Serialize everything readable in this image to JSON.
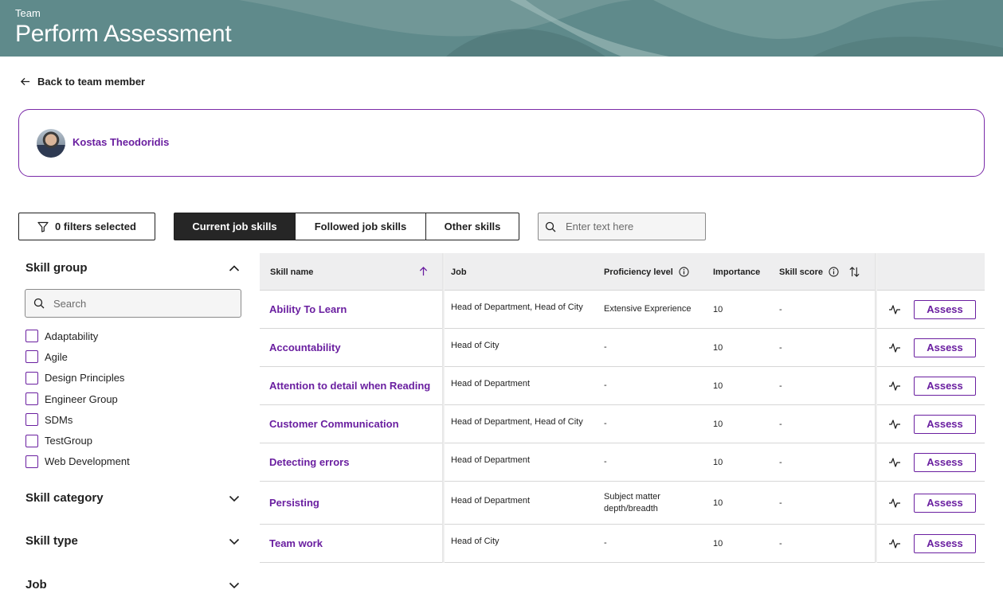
{
  "header": {
    "eyebrow": "Team",
    "title": "Perform Assessment"
  },
  "back_link": {
    "label": "Back to team member"
  },
  "member": {
    "name": "Kostas Theodoridis"
  },
  "toolbar": {
    "filters_label": "0 filters selected",
    "tabs": [
      {
        "label": "Current job skills",
        "active": true
      },
      {
        "label": "Followed job skills",
        "active": false
      },
      {
        "label": "Other skills",
        "active": false
      }
    ],
    "search_placeholder": "Enter text here"
  },
  "sidebar": {
    "skill_group": {
      "title": "Skill group",
      "expanded": true,
      "search_placeholder": "Search",
      "items": [
        "Adaptability",
        "Agile",
        "Design Principles",
        "Engineer Group",
        "SDMs",
        "TestGroup",
        "Web Development"
      ]
    },
    "skill_category": {
      "title": "Skill category",
      "expanded": false
    },
    "skill_type": {
      "title": "Skill type",
      "expanded": false
    },
    "job": {
      "title": "Job",
      "expanded": false
    }
  },
  "table": {
    "columns": {
      "skill_name": "Skill name",
      "job": "Job",
      "proficiency": "Proficiency level",
      "importance": "Importance",
      "skill_score": "Skill score"
    },
    "assess_label": "Assess",
    "rows": [
      {
        "skill": "Ability To Learn",
        "job": "Head of Department, Head of City",
        "proficiency": "Extensive Exprerience",
        "importance": "10",
        "score": "-"
      },
      {
        "skill": "Accountability",
        "job": "Head of City",
        "proficiency": "-",
        "importance": "10",
        "score": "-"
      },
      {
        "skill": "Attention to detail when Reading",
        "job": "Head of Department",
        "proficiency": "-",
        "importance": "10",
        "score": "-"
      },
      {
        "skill": "Customer Communication",
        "job": "Head of Department, Head of City",
        "proficiency": "-",
        "importance": "10",
        "score": "-"
      },
      {
        "skill": "Detecting errors",
        "job": "Head of Department",
        "proficiency": "-",
        "importance": "10",
        "score": "-"
      },
      {
        "skill": "Persisting",
        "job": "Head of Department",
        "proficiency": "Subject matter depth/breadth",
        "importance": "10",
        "score": "-"
      },
      {
        "skill": "Team work",
        "job": "Head of City",
        "proficiency": "-",
        "importance": "10",
        "score": "-"
      }
    ]
  },
  "colors": {
    "accent": "#6a1fa0",
    "banner": "#5f8a8b",
    "active_tab": "#262626"
  },
  "icons": {
    "back": "arrow-left-icon",
    "filter": "funnel-icon",
    "search": "search-icon",
    "sort_asc": "arrow-up-icon",
    "sort": "sort-icon",
    "info": "info-icon",
    "activity": "pulse-icon",
    "expand": "chevron-down-icon",
    "collapse": "chevron-up-icon"
  }
}
